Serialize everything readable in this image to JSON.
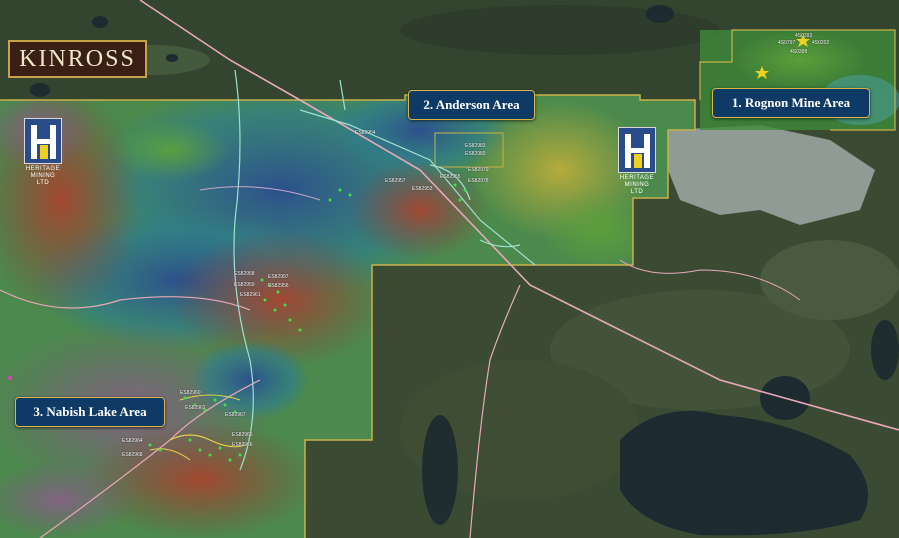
{
  "brand": {
    "name": "KINROSS"
  },
  "areas": [
    {
      "id": "rognon",
      "label": "1. Rognon Mine Area"
    },
    {
      "id": "anderson",
      "label": "2. Anderson Area"
    },
    {
      "id": "nabish",
      "label": "3. Nabish Lake Area"
    }
  ],
  "partner_logo": {
    "line1": "HERITAGE",
    "line2": "MINING LTD"
  },
  "claims": [
    "ES82954",
    "ES82983",
    "ES82980",
    "ES82979",
    "ES82978",
    "ES82957",
    "ES82953",
    "ES82955",
    "ES82958",
    "ES82997",
    "ES82959",
    "ES82956",
    "ES82961",
    "ES82960",
    "ES82962",
    "ES82967",
    "ES82965",
    "ES82964",
    "ES82966",
    "ES82968",
    "4S0797",
    "4S0393",
    "4S0398",
    "4S0202"
  ],
  "colors": {
    "label_bg": "#103a66",
    "label_border": "#d9b44a",
    "boundary": "#c9b24a",
    "road": "#e8a8b8",
    "trail": "#9fe0d0"
  }
}
